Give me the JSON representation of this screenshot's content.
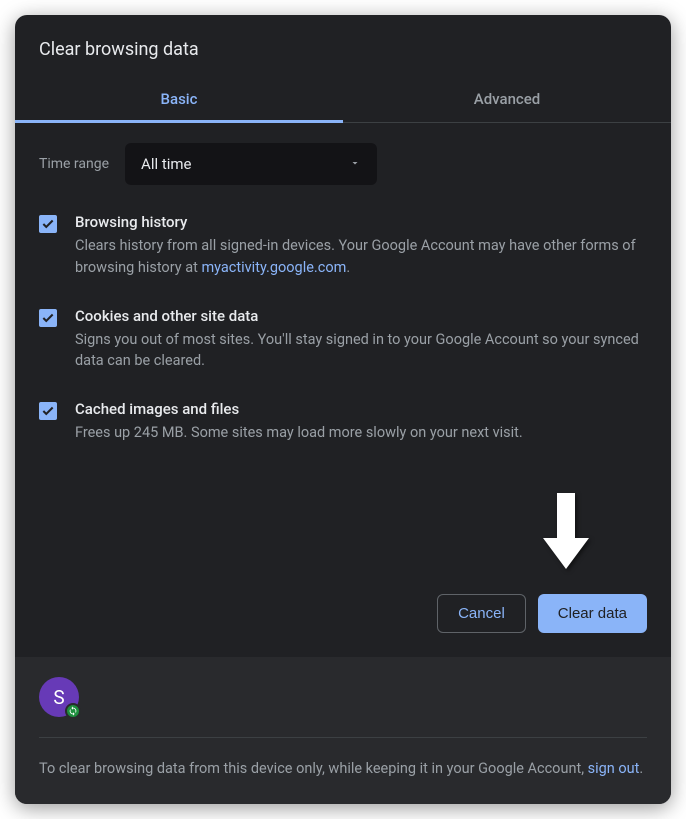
{
  "dialog": {
    "title": "Clear browsing data"
  },
  "tabs": {
    "basic": "Basic",
    "advanced": "Advanced"
  },
  "timeRange": {
    "label": "Time range",
    "value": "All time"
  },
  "items": {
    "browsingHistory": {
      "title": "Browsing history",
      "descPrefix": "Clears history from all signed-in devices. Your Google Account may have other forms of browsing history at ",
      "link": "myactivity.google.com",
      "descSuffix": "."
    },
    "cookies": {
      "title": "Cookies and other site data",
      "desc": "Signs you out of most sites. You'll stay signed in to your Google Account so your synced data can be cleared."
    },
    "cache": {
      "title": "Cached images and files",
      "desc": "Frees up 245 MB. Some sites may load more slowly on your next visit."
    }
  },
  "buttons": {
    "cancel": "Cancel",
    "clearData": "Clear data"
  },
  "avatar": {
    "initial": "S"
  },
  "footer": {
    "textPrefix": "To clear browsing data from this device only, while keeping it in your Google Account, ",
    "link": "sign out",
    "textSuffix": "."
  }
}
